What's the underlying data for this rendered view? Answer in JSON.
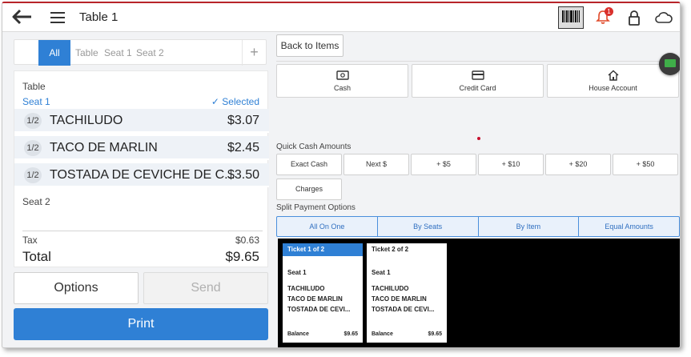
{
  "header": {
    "title": "Table 1",
    "notification_count": "1"
  },
  "tabs": {
    "items": [
      "All",
      "Table",
      "Seat 1",
      "Seat 2"
    ],
    "add": "+"
  },
  "order": {
    "table_label": "Table",
    "seat1_label": "Seat 1",
    "selected_label": "✓  Selected",
    "items": [
      {
        "qty": "1/2",
        "name": "TACHILUDO",
        "price": "$3.07"
      },
      {
        "qty": "1/2",
        "name": "TACO DE MARLIN",
        "price": "$2.45"
      },
      {
        "qty": "1/2",
        "name": "TOSTADA DE CEVICHE DE C...",
        "price": "$3.50"
      }
    ],
    "seat2_label": "Seat 2",
    "tax_label": "Tax",
    "tax_value": "$0.63",
    "total_label": "Total",
    "total_value": "$9.65"
  },
  "actions": {
    "options": "Options",
    "send": "Send",
    "print": "Print"
  },
  "payment": {
    "back_label": "Back to Items",
    "methods": [
      {
        "label": "Cash",
        "icon": "cash-icon"
      },
      {
        "label": "Credit Card",
        "icon": "credit-card-icon"
      },
      {
        "label": "House Account",
        "icon": "house-icon"
      }
    ],
    "quick_cash_title": "Quick Cash Amounts",
    "quick_cash": [
      "Exact Cash",
      "Next $",
      "+ $5",
      "+ $10",
      "+ $20",
      "+ $50"
    ],
    "charges": "Charges",
    "split_title": "Split Payment Options",
    "split_options": [
      "All On One",
      "By Seats",
      "By Item",
      "Equal Amounts"
    ]
  },
  "tickets": [
    {
      "header": "Ticket 1 of 2",
      "seat": "Seat 1",
      "items": [
        "TACHILUDO",
        "TACO DE MARLIN",
        "TOSTADA DE CEVI..."
      ],
      "balance_label": "Balance",
      "balance": "$9.65"
    },
    {
      "header": "Ticket 2 of 2",
      "seat": "Seat 1",
      "items": [
        "TACHILUDO",
        "TACO DE MARLIN",
        "TOSTADA DE CEVI..."
      ],
      "balance_label": "Balance",
      "balance": "$9.65"
    }
  ],
  "colors": {
    "accent": "#2f80d5",
    "alert": "#d9302c",
    "chat": "#3fae49"
  }
}
